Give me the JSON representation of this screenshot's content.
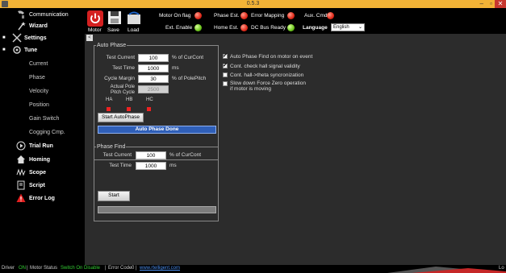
{
  "window": {
    "title": "0.5.3",
    "min": "–",
    "max": "▫",
    "close": "✕"
  },
  "sidebar": {
    "items": [
      {
        "label": "Communication",
        "icon": "communication-icon"
      },
      {
        "label": "Wizard",
        "icon": "wizard-icon"
      },
      {
        "label": "Settings",
        "icon": "settings-icon"
      },
      {
        "label": "Tune",
        "icon": "tune-icon"
      },
      {
        "label": "Current"
      },
      {
        "label": "Phase"
      },
      {
        "label": "Velocity"
      },
      {
        "label": "Position"
      },
      {
        "label": "Gain Switch"
      },
      {
        "label": "Cogging Cmp."
      },
      {
        "label": "Trial Run",
        "icon": "play-icon"
      },
      {
        "label": "Homing",
        "icon": "home-icon"
      },
      {
        "label": "Scope",
        "icon": "scope-icon"
      },
      {
        "label": "Script",
        "icon": "script-icon"
      },
      {
        "label": "Error Log",
        "icon": "warning-icon"
      }
    ],
    "expand_marker": "■"
  },
  "toolbar": {
    "motor_label": "Motor",
    "save_label": "Save",
    "load_label": "Load",
    "motor_on_flag": "Motor On flag",
    "ext_enable": "Ext. Enable",
    "phase_est": "Phase Est.",
    "home_est": "Home Est.",
    "error_mapping": "Error Mapping",
    "dc_bus_ready": "DC Bus Ready",
    "aux_cmd": "Aux. Cmd.",
    "language_label": "Language",
    "language_value": "English",
    "colors": {
      "red": "#e02a1a",
      "green": "#6cc51c",
      "power": "#d42020"
    }
  },
  "auto_phase": {
    "legend": "Auto Phase",
    "test_current_label": "Test Current",
    "test_current_value": "100",
    "test_current_unit": "% of CurCont",
    "test_time_label": "Test Time",
    "test_time_value": "1000",
    "test_time_unit": "ms",
    "cycle_margin_label": "Cycle Margin",
    "cycle_margin_value": "30",
    "cycle_margin_unit": "% of PolePitch",
    "actual_pole_label_1": "Actual Pole",
    "actual_pole_label_2": "Pitch Cycle",
    "actual_pole_value": "2500",
    "hall_labels": [
      "HA",
      "HB",
      "HC"
    ],
    "start_button": "Start AutoPhase",
    "status": "Auto Phase Done"
  },
  "options": [
    {
      "label": "Auto Phase Find on motor on event",
      "checked": true
    },
    {
      "label": "Cont. check hall signal validity",
      "checked": true
    },
    {
      "label": "Cont. hall->theta syncronization",
      "checked": false
    },
    {
      "label_1": "Slow down Force Zero operation",
      "label_2": "if motor is moving",
      "checked": false
    }
  ],
  "phase_find": {
    "legend": "Phase Find",
    "test_current_label": "Test Current",
    "test_current_value": "100",
    "test_current_unit": "% of CurCont",
    "test_time_label": "Test Time",
    "test_time_value": "1000",
    "test_time_unit": "ms",
    "start_button": "Start"
  },
  "statusbar": {
    "driver_label": "Driver",
    "driver_value": "ON",
    "motor_status_label": "Motor Status",
    "motor_status_value": "Switch On Disable",
    "error_code_label": "Error Code",
    "error_code_value": "0",
    "link": "www.rtelligent.com",
    "right": "Lo"
  }
}
